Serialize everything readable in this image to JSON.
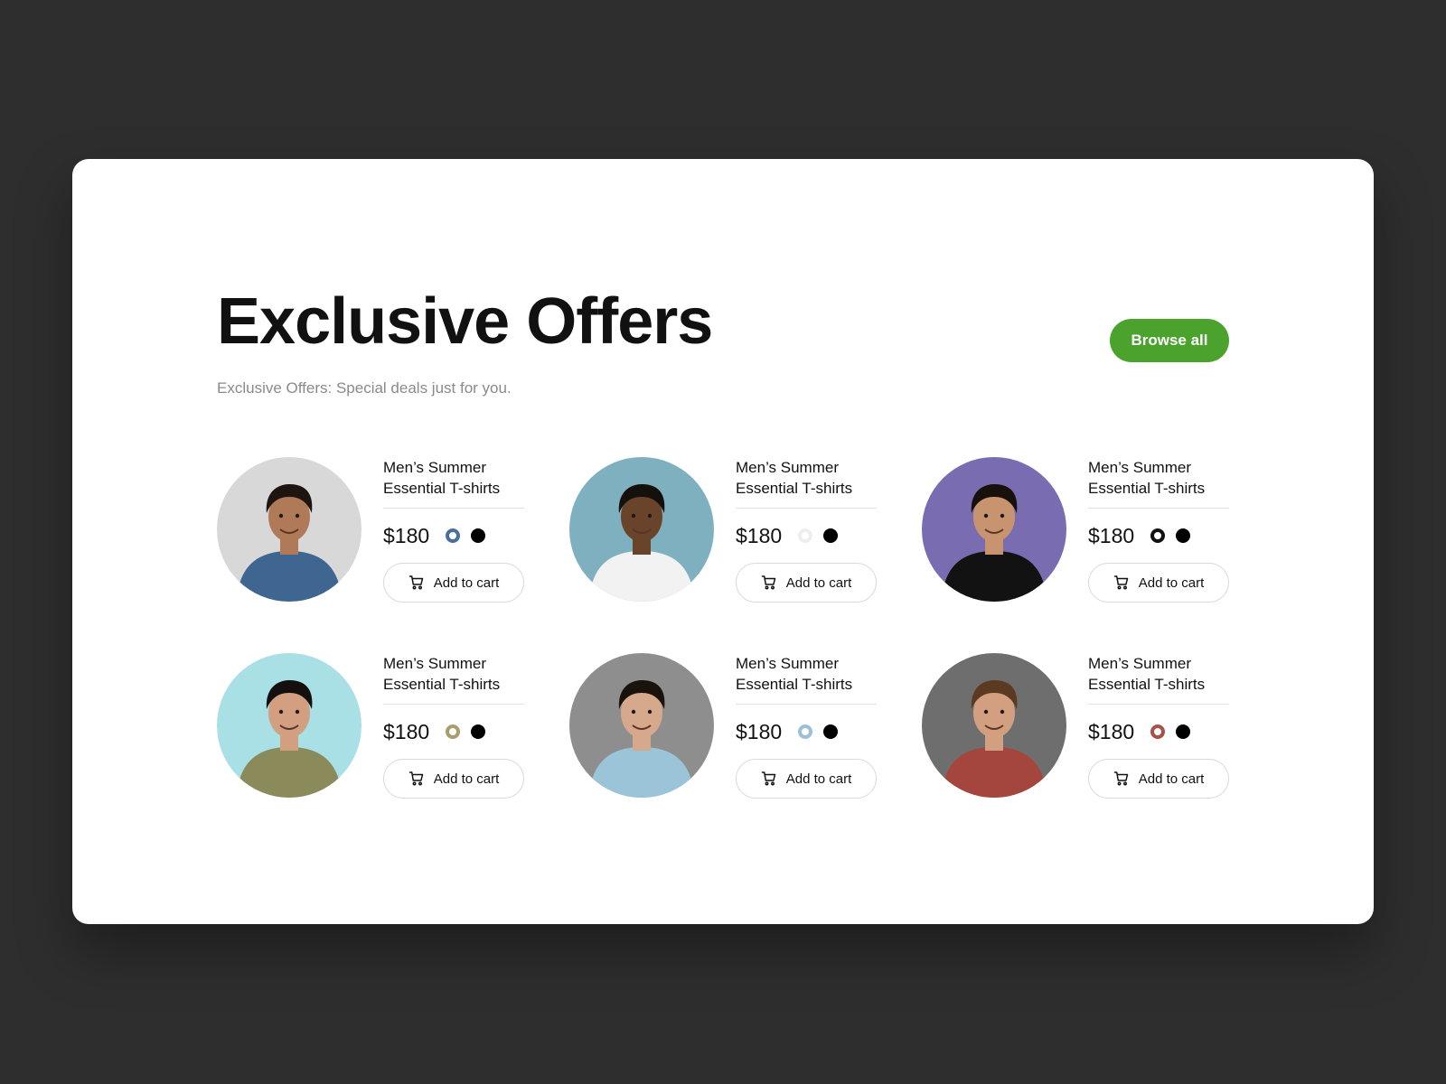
{
  "header": {
    "title": "Exclusive Offers",
    "subtitle": "Exclusive Offers: Special deals just for you.",
    "browse_label": "Browse all"
  },
  "colors": {
    "accent": "#4ba32e",
    "background": "#2e2e2e",
    "card": "#ffffff"
  },
  "products": [
    {
      "name": "Men’s Summer Essential T-shirts",
      "price": "$180",
      "cart_label": "Add to cart",
      "cart_icon": "shopping-cart-icon",
      "photo_bg": "#d8d8d8",
      "shirt": "#3f6690",
      "skin": "#b07a58",
      "hair": "#1e1510",
      "swatches": [
        {
          "color": "#4a6f9a",
          "selected": true
        },
        {
          "color": "#000000",
          "selected": false
        }
      ]
    },
    {
      "name": "Men’s Summer Essential T-shirts",
      "price": "$180",
      "cart_label": "Add to cart",
      "cart_icon": "shopping-cart-icon",
      "photo_bg": "#7fb0c0",
      "shirt": "#f2f2f2",
      "skin": "#6a432b",
      "hair": "#14100c",
      "swatches": [
        {
          "color": "#eeeeee",
          "selected": true
        },
        {
          "color": "#000000",
          "selected": false
        }
      ]
    },
    {
      "name": "Men’s Summer Essential T-shirts",
      "price": "$180",
      "cart_label": "Add to cart",
      "cart_icon": "shopping-cart-icon",
      "photo_bg": "#7a6cb0",
      "shirt": "#121212",
      "skin": "#c89470",
      "hair": "#17100b",
      "swatches": [
        {
          "color": "#111111",
          "selected": true
        },
        {
          "color": "#000000",
          "selected": false
        }
      ]
    },
    {
      "name": "Men’s Summer Essential T-shirts",
      "price": "$180",
      "cart_label": "Add to cart",
      "cart_icon": "shopping-cart-icon",
      "photo_bg": "#a8e0e6",
      "shirt": "#8a8a5a",
      "skin": "#d2a080",
      "hair": "#141010",
      "swatches": [
        {
          "color": "#a89c70",
          "selected": true
        },
        {
          "color": "#000000",
          "selected": false
        }
      ]
    },
    {
      "name": "Men’s Summer Essential T-shirts",
      "price": "$180",
      "cart_label": "Add to cart",
      "cart_icon": "shopping-cart-icon",
      "photo_bg": "#8e8e8e",
      "shirt": "#9cc4d8",
      "skin": "#d6a88c",
      "hair": "#1a120d",
      "swatches": [
        {
          "color": "#9cc0d4",
          "selected": true
        },
        {
          "color": "#000000",
          "selected": false
        }
      ]
    },
    {
      "name": "Men’s Summer Essential T-shirts",
      "price": "$180",
      "cart_label": "Add to cart",
      "cart_icon": "shopping-cart-icon",
      "photo_bg": "#6e6e6e",
      "shirt": "#a5463e",
      "skin": "#d2a080",
      "hair": "#5c3a22",
      "swatches": [
        {
          "color": "#a8504a",
          "selected": true
        },
        {
          "color": "#000000",
          "selected": false
        }
      ]
    }
  ]
}
